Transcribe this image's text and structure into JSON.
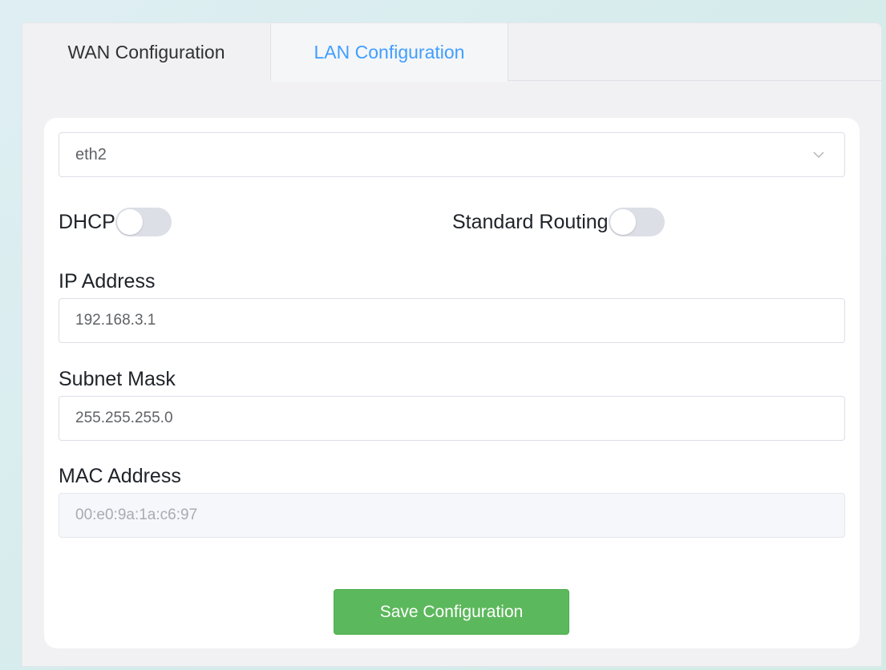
{
  "tabs": [
    {
      "label": "WAN Configuration",
      "active": false
    },
    {
      "label": "LAN Configuration",
      "active": true
    }
  ],
  "interface_select": {
    "value": "eth2",
    "icon": "chevron-down-icon"
  },
  "toggles": {
    "dhcp": {
      "label": "DHCP",
      "on": false
    },
    "standard_routing": {
      "label": "Standard Routing",
      "on": false
    }
  },
  "fields": {
    "ip_address": {
      "label": "IP Address",
      "value": "192.168.3.1"
    },
    "subnet_mask": {
      "label": "Subnet Mask",
      "value": "255.255.255.0"
    },
    "mac_address": {
      "label": "MAC Address",
      "value": "00:e0:9a:1a:c6:97",
      "disabled": true
    }
  },
  "save_button": {
    "label": "Save Configuration"
  },
  "colors": {
    "active_tab": "#409eff",
    "save_button": "#5cb85c",
    "switch_off": "#dcdfe6"
  }
}
